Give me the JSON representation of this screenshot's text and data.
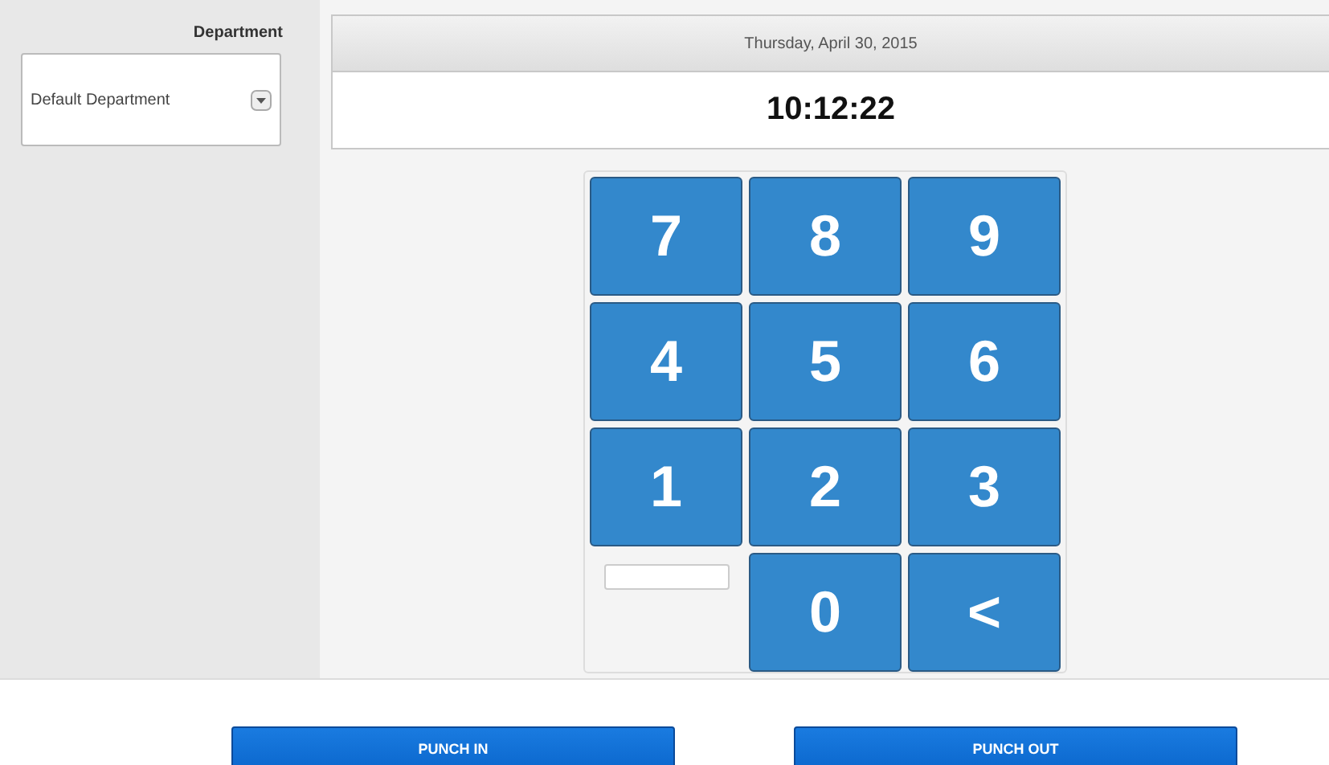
{
  "sidebar": {
    "label": "Department",
    "department_select": {
      "value": "Default Department"
    }
  },
  "clock": {
    "date": "Thursday, April 30, 2015",
    "time": "10:12:22"
  },
  "keypad": {
    "keys": [
      "7",
      "8",
      "9",
      "4",
      "5",
      "6",
      "1",
      "2",
      "3"
    ],
    "bottom_keys": [
      "0",
      "<"
    ]
  },
  "buttons": [
    "PUNCH IN",
    "PUNCH OUT"
  ]
}
